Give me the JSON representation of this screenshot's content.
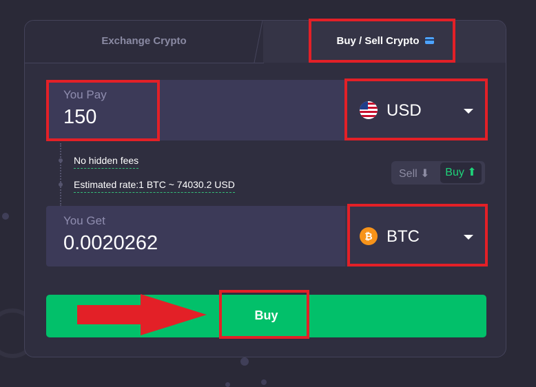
{
  "tabs": {
    "exchange_label": "Exchange Crypto",
    "buysell_label": "Buy / Sell Crypto"
  },
  "pay": {
    "label": "You Pay",
    "value": "150",
    "currency": "USD",
    "currency_icon": "us-flag-icon"
  },
  "info": {
    "fees": "No hidden fees",
    "rate": "Estimated rate:1 BTC ~ 74030.2 USD"
  },
  "mode_toggle": {
    "sell_label": "Sell",
    "buy_label": "Buy",
    "selected": "Buy"
  },
  "get": {
    "label": "You Get",
    "value": "0.0020262",
    "currency": "BTC",
    "currency_icon": "bitcoin-icon"
  },
  "buy_button": {
    "label": "Buy"
  },
  "colors": {
    "accent": "#02c06a",
    "background": "#2a2937",
    "card": "#2f2e3f",
    "annotation": "#e32027"
  }
}
